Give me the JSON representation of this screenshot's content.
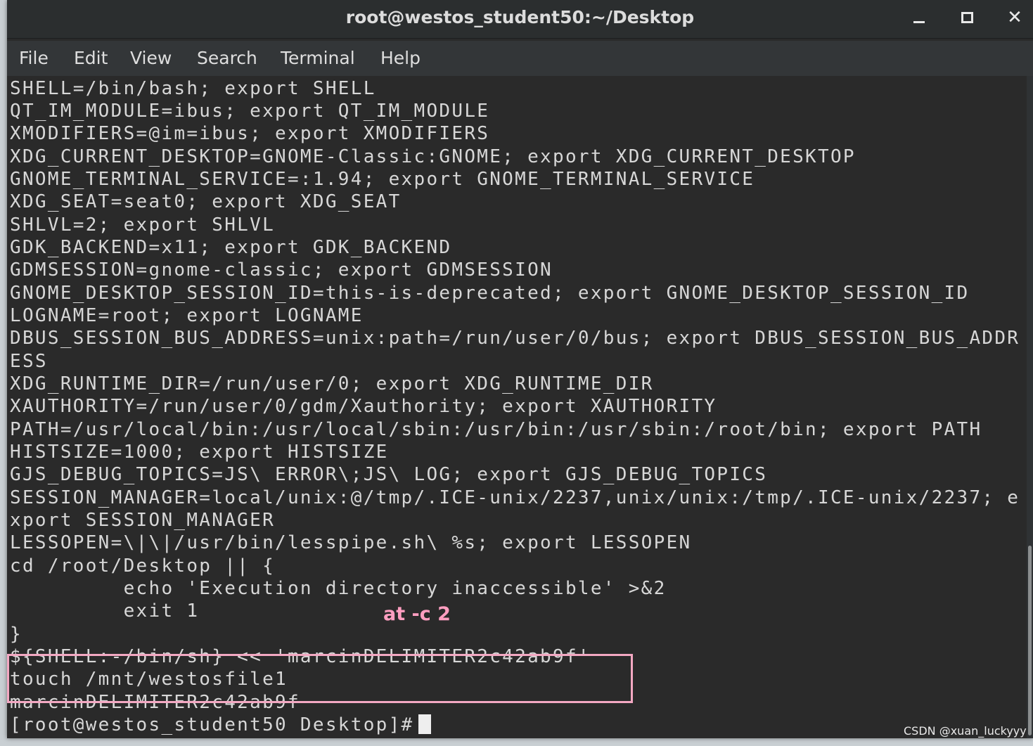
{
  "window": {
    "title": "root@westos_student50:~/Desktop",
    "minimize_icon": "minimize-icon",
    "maximize_icon": "maximize-icon",
    "close_icon": "close-icon",
    "close_glyph": "✕"
  },
  "menu": {
    "items": [
      "File",
      "Edit",
      "View",
      "Search",
      "Terminal",
      "Help"
    ]
  },
  "terminal": {
    "lines": [
      "SHELL=/bin/bash; export SHELL",
      "QT_IM_MODULE=ibus; export QT_IM_MODULE",
      "XMODIFIERS=@im=ibus; export XMODIFIERS",
      "XDG_CURRENT_DESKTOP=GNOME-Classic:GNOME; export XDG_CURRENT_DESKTOP",
      "GNOME_TERMINAL_SERVICE=:1.94; export GNOME_TERMINAL_SERVICE",
      "XDG_SEAT=seat0; export XDG_SEAT",
      "SHLVL=2; export SHLVL",
      "GDK_BACKEND=x11; export GDK_BACKEND",
      "GDMSESSION=gnome-classic; export GDMSESSION",
      "GNOME_DESKTOP_SESSION_ID=this-is-deprecated; export GNOME_DESKTOP_SESSION_ID",
      "LOGNAME=root; export LOGNAME",
      "DBUS_SESSION_BUS_ADDRESS=unix:path=/run/user/0/bus; export DBUS_SESSION_BUS_ADDR",
      "ESS",
      "XDG_RUNTIME_DIR=/run/user/0; export XDG_RUNTIME_DIR",
      "XAUTHORITY=/run/user/0/gdm/Xauthority; export XAUTHORITY",
      "PATH=/usr/local/bin:/usr/local/sbin:/usr/bin:/usr/sbin:/root/bin; export PATH",
      "HISTSIZE=1000; export HISTSIZE",
      "GJS_DEBUG_TOPICS=JS\\ ERROR\\;JS\\ LOG; export GJS_DEBUG_TOPICS",
      "SESSION_MANAGER=local/unix:@/tmp/.ICE-unix/2237,unix/unix:/tmp/.ICE-unix/2237; e",
      "xport SESSION_MANAGER",
      "LESSOPEN=\\|\\|/usr/bin/lesspipe.sh\\ %s; export LESSOPEN",
      "cd /root/Desktop || {",
      "         echo 'Execution directory inaccessible' >&2",
      "         exit 1",
      "}",
      "${SHELL:-/bin/sh} << 'marcinDELIMITER2c42ab9f'",
      "touch /mnt/westosfile1",
      "marcinDELIMITER2c42ab9f"
    ],
    "prompt": "[root@westos_student50 Desktop]#"
  },
  "annotation": {
    "label": "at -c 2",
    "color": "#ff9ec0"
  },
  "watermark": "CSDN @xuan_luckyyy"
}
